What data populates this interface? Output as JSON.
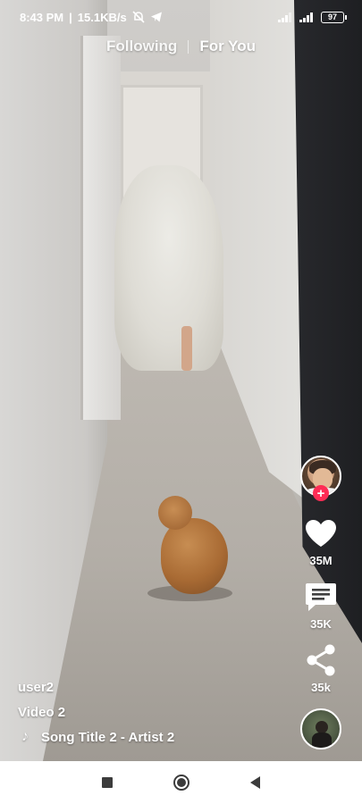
{
  "status_bar": {
    "time": "8:43 PM",
    "speed": "15.1KB/s",
    "battery": "97",
    "icons": [
      "alarm-off-icon",
      "telegram-icon",
      "signal-icon",
      "wifi-icon",
      "battery-icon"
    ]
  },
  "top_tabs": {
    "following": "Following",
    "for_you": "For You"
  },
  "actions": {
    "likes": "35M",
    "comments": "35K",
    "shares": "35k",
    "follow_symbol": "+",
    "accent_color": "#fe2c55"
  },
  "caption": {
    "username": "user2",
    "title": "Video 2",
    "song": "Song Title 2 - Artist 2"
  },
  "nav": {
    "icons": [
      "recents-square-icon",
      "home-circle-icon",
      "back-triangle-icon"
    ]
  }
}
